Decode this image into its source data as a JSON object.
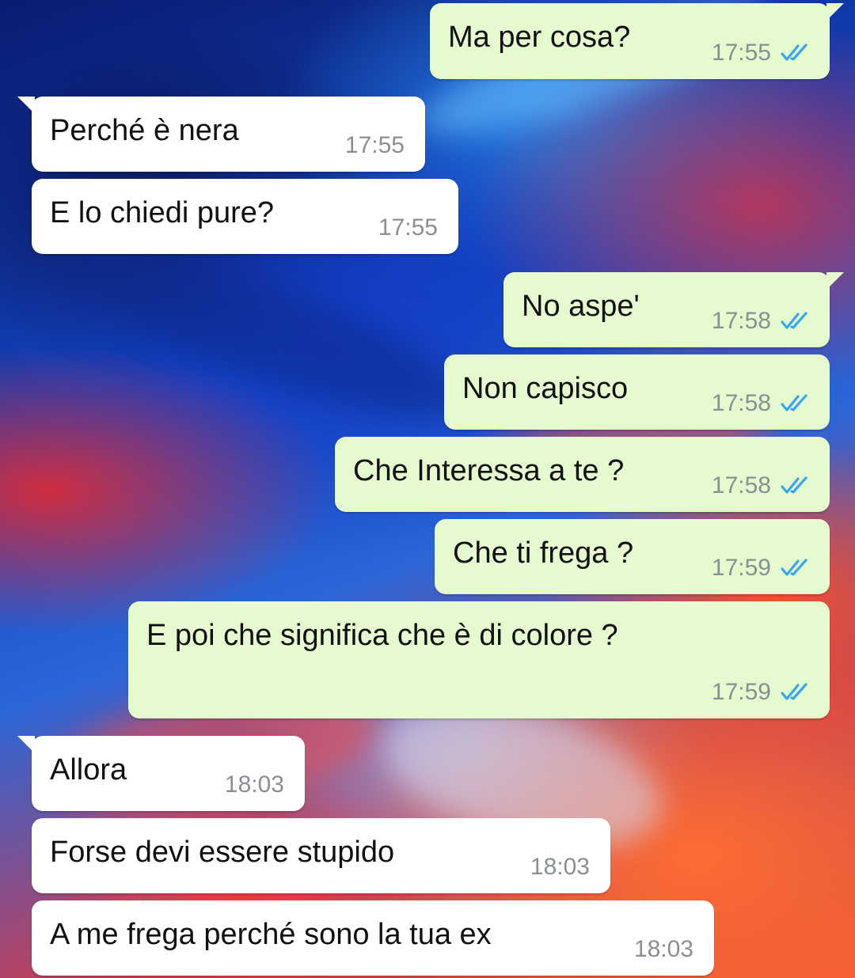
{
  "colors": {
    "incoming_bubble": "#ffffff",
    "outgoing_bubble": "#e5fbcf",
    "timestamp": "#8a8f93",
    "read_ticks": "#3aa6f0"
  },
  "messages": [
    {
      "direction": "outgoing",
      "text": "Ma per cosa?",
      "time": "17:55",
      "status_icon": "double-check-read-icon"
    },
    {
      "direction": "incoming",
      "text": "Perché è nera",
      "time": "17:55"
    },
    {
      "direction": "incoming",
      "text": "E lo chiedi pure?",
      "time": "17:55"
    },
    {
      "direction": "outgoing",
      "text": "No aspe'",
      "time": "17:58",
      "status_icon": "double-check-read-icon"
    },
    {
      "direction": "outgoing",
      "text": "Non capisco",
      "time": "17:58",
      "status_icon": "double-check-read-icon"
    },
    {
      "direction": "outgoing",
      "text": "Che Interessa a te ?",
      "time": "17:58",
      "status_icon": "double-check-read-icon"
    },
    {
      "direction": "outgoing",
      "text": "Che ti frega ?",
      "time": "17:59",
      "status_icon": "double-check-read-icon"
    },
    {
      "direction": "outgoing",
      "text": "E poi che significa che è di colore ?",
      "time": "17:59",
      "status_icon": "double-check-read-icon"
    },
    {
      "direction": "incoming",
      "text": "Allora",
      "time": "18:03"
    },
    {
      "direction": "incoming",
      "text": "Forse devi essere stupido",
      "time": "18:03"
    },
    {
      "direction": "incoming",
      "text": "A me frega perché sono la tua ex",
      "time": "18:03"
    }
  ]
}
